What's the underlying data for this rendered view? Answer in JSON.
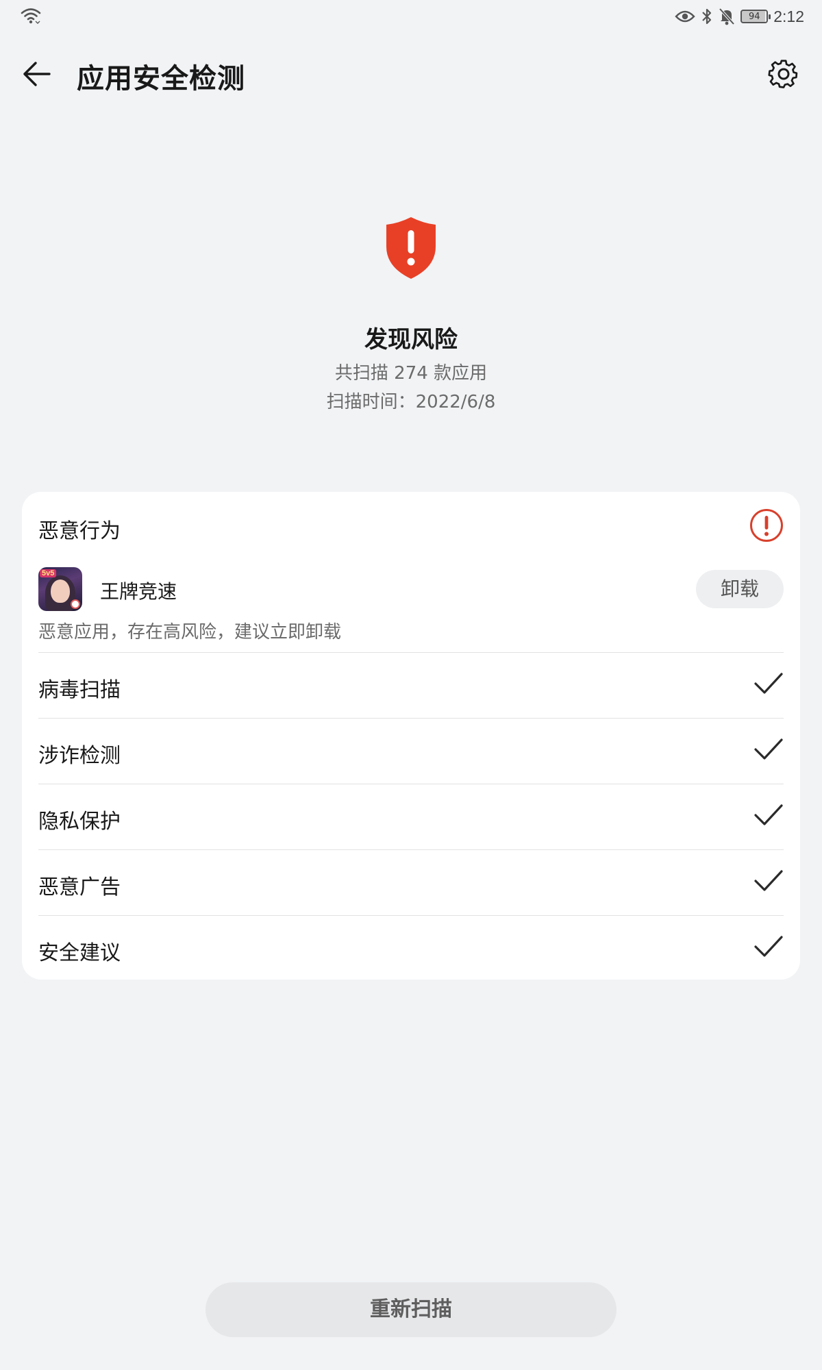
{
  "status_bar": {
    "icons": [
      "wifi-icon",
      "eye-icon",
      "bluetooth-icon",
      "mute-bell-icon",
      "battery-icon"
    ],
    "battery_level": 94,
    "battery_text": "94",
    "time": "2:12"
  },
  "header": {
    "title": "应用安全检测",
    "back_icon": "back-arrow-icon",
    "settings_icon": "gear-icon"
  },
  "summary": {
    "status_icon": "shield-alert-icon",
    "status_color": "#e84026",
    "title": "发现风险",
    "scan_count_text": "共扫描 274 款应用",
    "scan_time_text": "扫描时间：2022/6/8"
  },
  "malicious_section": {
    "title": "恶意行为",
    "alert_icon": "alert-circle-icon",
    "alert_color": "#d8402c",
    "app": {
      "name": "王牌竞速",
      "icon_badge": "5v5",
      "action_label": "卸载",
      "note": "恶意应用，存在高风险，建议立即卸载"
    }
  },
  "checks": [
    {
      "label": "病毒扫描",
      "icon": "check-icon"
    },
    {
      "label": "涉诈检测",
      "icon": "check-icon"
    },
    {
      "label": "隐私保护",
      "icon": "check-icon"
    },
    {
      "label": "恶意广告",
      "icon": "check-icon"
    },
    {
      "label": "安全建议",
      "icon": "check-icon"
    }
  ],
  "footer": {
    "rescan_label": "重新扫描"
  }
}
